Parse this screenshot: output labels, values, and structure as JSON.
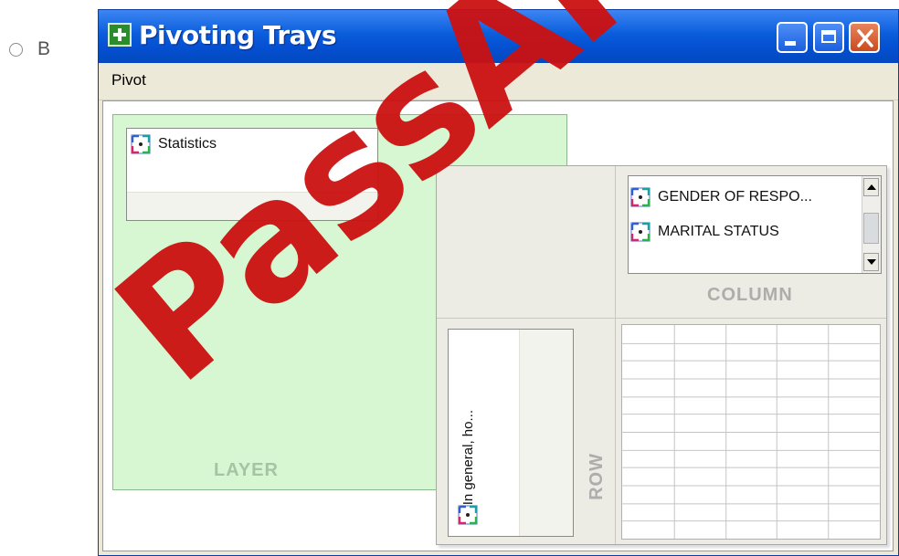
{
  "option": {
    "label": "B",
    "selected": false
  },
  "window": {
    "title": "Pivoting Trays",
    "menu": {
      "pivot": "Pivot"
    }
  },
  "trays": {
    "layer": {
      "label": "LAYER",
      "items": [
        "Statistics"
      ]
    },
    "column": {
      "label": "COLUMN",
      "items": [
        "GENDER OF RESPO...",
        "MARITAL STATUS"
      ]
    },
    "row": {
      "label": "ROW",
      "items": [
        "In general, ho..."
      ]
    }
  },
  "grid": {
    "rows": 12,
    "cols": 5
  },
  "watermark": "PassAP",
  "colors": {
    "layer_bg": "#d6f7d2",
    "watermark": "#cc1111",
    "titlebar": "#0450d2"
  }
}
